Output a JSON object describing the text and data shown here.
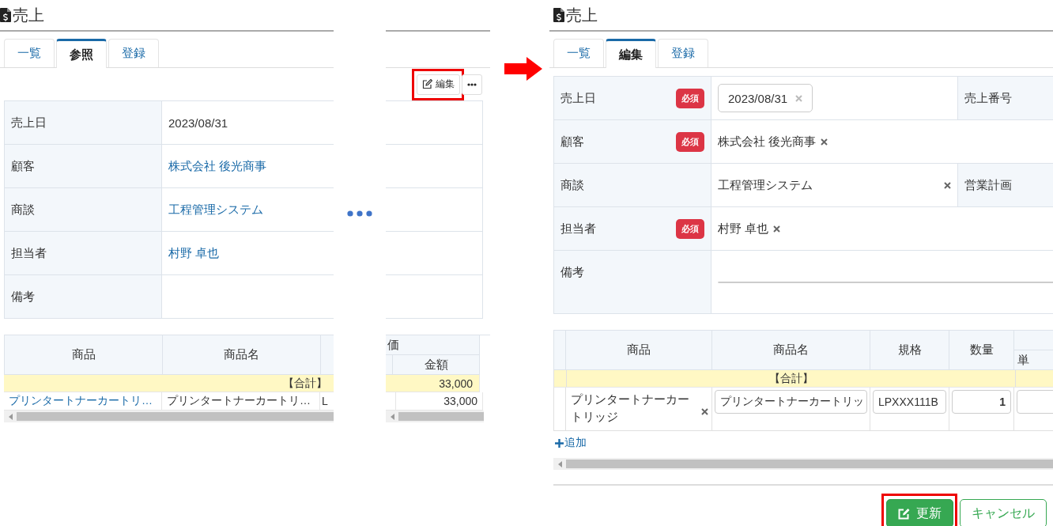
{
  "view_screen": {
    "title": "売上",
    "tabs": [
      {
        "label": "一覧",
        "selected": false
      },
      {
        "label": "参照",
        "selected": true
      },
      {
        "label": "登録",
        "selected": false
      }
    ],
    "actions": [
      {
        "kind": "edit",
        "label": "編集",
        "highlighted": true
      },
      {
        "kind": "more",
        "highlighted": false
      }
    ],
    "fields": [
      {
        "label": "売上日",
        "value": "2023/08/31",
        "link": false
      },
      {
        "label": "顧客",
        "value": "株式会社 後光商事",
        "link": true
      },
      {
        "label": "商談",
        "value": "工程管理システム",
        "link": true
      },
      {
        "label": "担当者",
        "value": "村野 卓也",
        "link": true
      },
      {
        "label": "備考"
      }
    ],
    "items": {
      "columns": [
        "商品",
        "商品名"
      ],
      "group_header": "価",
      "right_columns": [
        "金額"
      ],
      "total_label": "【合計】",
      "total_amount": "33,000",
      "rows": [
        {
          "product": "プリンタートナーカートリ…",
          "name": "プリンタートナーカートリ…",
          "spec": "L",
          "amount": "33,000"
        }
      ]
    }
  },
  "edit_screen": {
    "title": "売上",
    "tabs": [
      {
        "label": "一覧",
        "selected": false
      },
      {
        "label": "編集",
        "selected": true
      },
      {
        "label": "登録",
        "selected": false
      }
    ],
    "fields": [
      {
        "label": "売上日",
        "badge": "必須",
        "kind": "date",
        "value": "2023/08/31",
        "side_label": "売上番号"
      },
      {
        "label": "顧客",
        "badge": "必須",
        "kind": "tag",
        "value": "株式会社 後光商事"
      },
      {
        "label": "商談",
        "kind": "combo",
        "value": "工程管理システム",
        "side_label": "営業計画"
      },
      {
        "label": "担当者",
        "badge": "必須",
        "kind": "tag",
        "value": "村野 卓也"
      },
      {
        "label": "備考",
        "kind": "textarea"
      }
    ],
    "items": {
      "columns": [
        "商品",
        "商品名",
        "規格",
        "数量"
      ],
      "subcolumn": "単",
      "total_label": "【合計】",
      "rows": [
        {
          "product": "プリンタートナーカートリッジ",
          "name": "プリンタートナーカートリッ",
          "spec": "LPXXX111B",
          "quantity": "1"
        }
      ]
    },
    "add_link": "追加",
    "buttons": [
      {
        "kind": "primary",
        "label": "更新",
        "highlighted": true
      },
      {
        "kind": "outline",
        "label": "キャンセル",
        "highlighted": false
      }
    ]
  }
}
